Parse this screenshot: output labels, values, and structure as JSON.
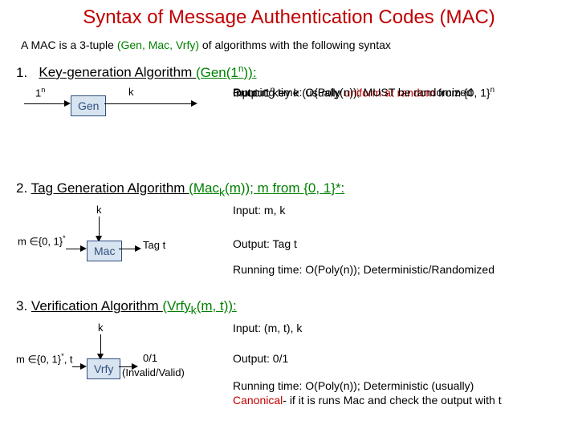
{
  "title": "Syntax of Message Authentication Codes (MAC)",
  "intro_pre": "A MAC is a 3-tuple ",
  "intro_tuple": "(Gen, Mac, Vrfy)",
  "intro_post": " of algorithms with the following syntax",
  "s1": {
    "num": "1.",
    "label": "Key-generation Algorithm ",
    "green": "(Gen(1",
    "sup": "n",
    "green2": ")):",
    "in_top": "1",
    "in_top_sup": "n",
    "box": "Gen",
    "out": "k",
    "d1a": "Input:  1",
    "d1sup": "n",
    "d2a": "Output: key k (usually ",
    "d2b": "uniform at random",
    "d2c": " from {0, 1}",
    "d2sup": "n",
    "d3": "Running time: O(Poly(n)); MUST be randomized"
  },
  "s2": {
    "num": "2.",
    "label": "Tag Generation Algorithm ",
    "green": "(Mac",
    "sub": "k",
    "green2": "(m)); m from {0, 1}*:",
    "k": "k",
    "in": "m ∈{0, 1}",
    "in_sup": "*",
    "box": "Mac",
    "out": "Tag t",
    "d1": "Input:  m, k",
    "d2": "Output: Tag t",
    "d3": "Running time: O(Poly(n));  Deterministic/Randomized"
  },
  "s3": {
    "num": "3.",
    "label": "Verification Algorithm ",
    "green": "(Vrfy",
    "sub": "k",
    "green2": "(m, t)):",
    "k": "k",
    "in": "m ∈{0, 1}",
    "in_sup": "*",
    "in_post": ", t",
    "box": "Vrfy",
    "out1": "0/1",
    "out2": "(Invalid/Valid)",
    "d1": "Input:  (m, t), k",
    "d2": "Output: 0/1",
    "d3a": "Running time: O(Poly(n));  Deterministic (usually)",
    "d4a": "Canonical",
    "d4b": "- if it is runs Mac and check the output with t"
  }
}
